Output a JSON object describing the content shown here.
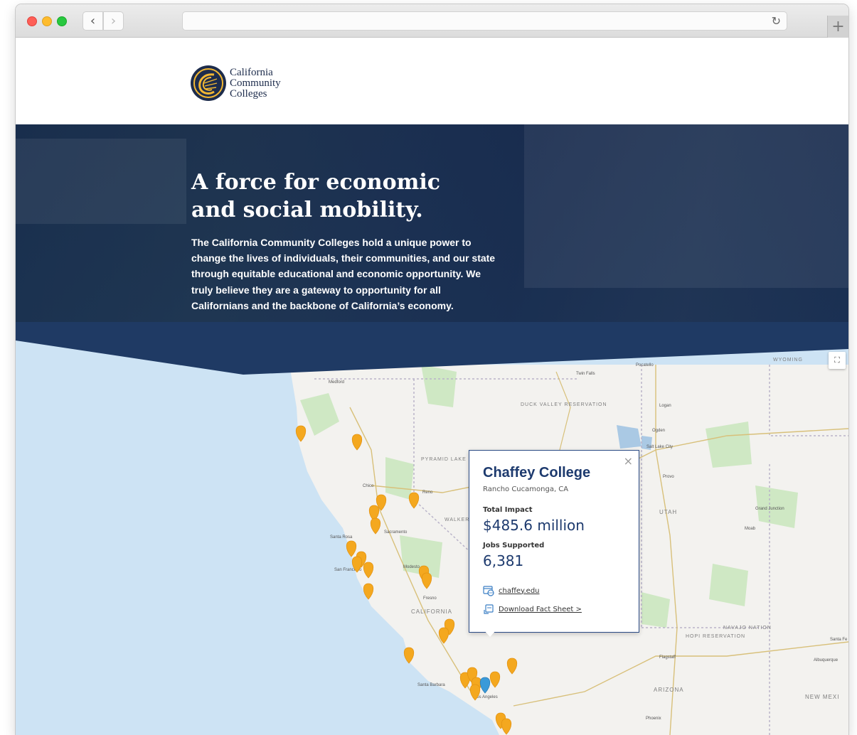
{
  "browser": {
    "back_icon": "chevron-left-icon",
    "forward_icon": "chevron-right-icon",
    "reload_icon": "reload-icon",
    "new_tab_label": "+"
  },
  "logo": {
    "line1": "California",
    "line2": "Community",
    "line3": "Colleges",
    "colors": {
      "navy": "#1d2c4c",
      "gold": "#f2b733"
    }
  },
  "hero": {
    "title_line1": "A force for economic",
    "title_line2": "and social mobility.",
    "body": "The California Community Colleges hold a unique power to change the lives of individuals, their communities, and our state through equitable educational and economic opportunity. We truly believe they are a gateway to opportunity for all Californians and the backbone of California’s economy."
  },
  "map": {
    "labels": [
      "WYOMING",
      "DUCK VALLEY RESERVATION",
      "PYRAMID LAKE PAIUTE RESERVATION",
      "WALKER RIVER RESERVATION",
      "CALIFORNIA",
      "UTAH",
      "ARIZONA",
      "NEW MEXI",
      "NAVAJO NATION",
      "HOPI RESERVATION",
      "Salt Lake City",
      "Reno",
      "Sacramento",
      "Modesto",
      "Fresno",
      "Santa Rosa",
      "San Francisco",
      "Los Angeles",
      "Phoenix",
      "Albuquerque",
      "Provo",
      "Ogden",
      "Logan",
      "Pocatello",
      "Twin Falls",
      "Medford",
      "Chico",
      "Santa Barbara",
      "Flagstaff",
      "Santa Fe",
      "Grand Junction",
      "Moab"
    ],
    "colors": {
      "water": "#cde3f4",
      "land": "#f3f2ef",
      "park": "#cfe8c4",
      "pin": "#f4a81f",
      "pin_selected": "#3a9ad9"
    }
  },
  "popup": {
    "name": "Chaffey College",
    "location": "Rancho Cucamonga, CA",
    "impact_label": "Total Impact",
    "impact_value": "$485.6 million",
    "jobs_label": "Jobs Supported",
    "jobs_value": "6,381",
    "website": "chaffey.edu",
    "factsheet": "Download Fact Sheet >",
    "close_label": "×"
  }
}
